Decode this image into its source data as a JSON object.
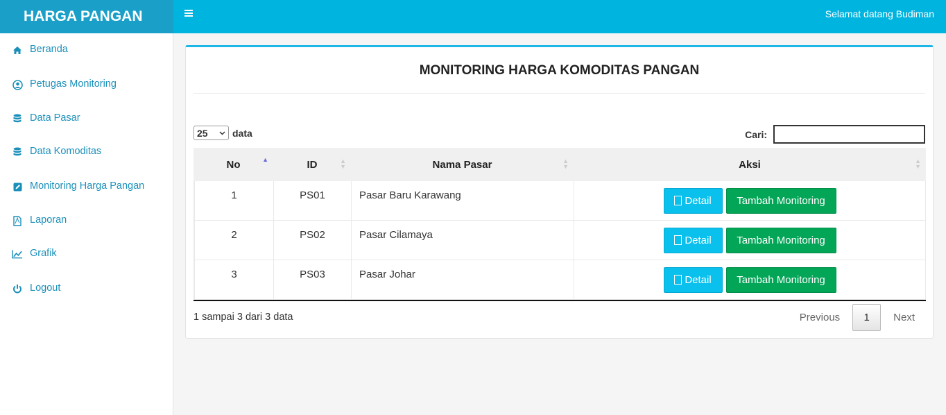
{
  "brand": "HARGA PANGAN",
  "header": {
    "welcome": "Selamat datang Budiman"
  },
  "sidebar": {
    "items": [
      {
        "label": "Beranda",
        "icon": "home-icon"
      },
      {
        "label": "Petugas Monitoring",
        "icon": "user-circle-icon"
      },
      {
        "label": "Data Pasar",
        "icon": "database-icon"
      },
      {
        "label": "Data Komoditas",
        "icon": "database-icon"
      },
      {
        "label": "Monitoring Harga Pangan",
        "icon": "edit-icon"
      },
      {
        "label": "Laporan",
        "icon": "pdf-file-icon"
      },
      {
        "label": "Grafik",
        "icon": "line-chart-icon"
      },
      {
        "label": "Logout",
        "icon": "power-icon"
      }
    ]
  },
  "main": {
    "title": "MONITORING HARGA KOMODITAS PANGAN",
    "length_value": "25",
    "length_suffix": "data",
    "search_label": "Cari:",
    "search_value": "",
    "columns": [
      "No",
      "ID",
      "Nama Pasar",
      "Aksi"
    ],
    "rows": [
      {
        "no": "1",
        "id": "PS01",
        "nama": "Pasar Baru Karawang"
      },
      {
        "no": "2",
        "id": "PS02",
        "nama": "Pasar Cilamaya"
      },
      {
        "no": "3",
        "id": "PS03",
        "nama": "Pasar Johar"
      }
    ],
    "detail_label": "Detail",
    "tambah_label": "Tambah Monitoring",
    "info": "1 sampai 3 dari 3 data",
    "pagination": {
      "previous": "Previous",
      "current": "1",
      "next": "Next"
    }
  },
  "colors": {
    "brand_bg": "#1aa0c8",
    "topbar_bg": "#00b4e0",
    "link": "#1a8fb9",
    "detail_btn": "#0ac0ec",
    "tambah_btn": "#03a557"
  }
}
